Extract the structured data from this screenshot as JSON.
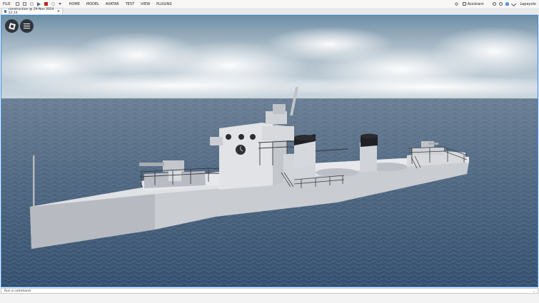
{
  "menubar": {
    "file_label": "FILE",
    "tabs": [
      "HOME",
      "MODEL",
      "AVATAR",
      "TEST",
      "VIEW",
      "PLUGINS"
    ],
    "assistant_label": "Assistant",
    "user_label": "Lepayolo"
  },
  "tab": {
    "title": "construction @ 29 Nov 2024 22:10",
    "close_glyph": "×"
  },
  "command_bar": {
    "placeholder": "Run a command",
    "chevron": "⌄"
  },
  "colors": {
    "accent": "#3c8be0",
    "stop_red": "#c42020",
    "sky_top": "#6f8fa6",
    "sea": "#3e5978",
    "hull": "#cfd2d6"
  }
}
